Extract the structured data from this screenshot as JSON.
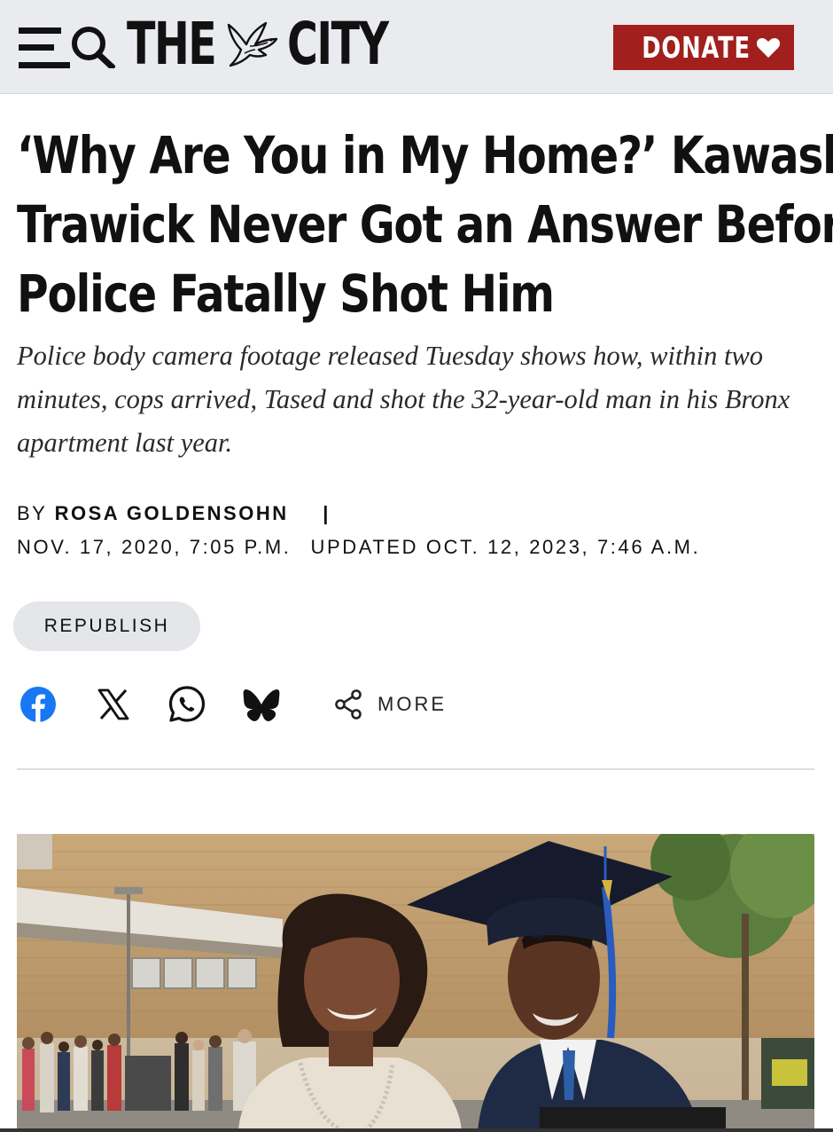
{
  "header": {
    "logo_left": "THE",
    "logo_right": "CITY",
    "donate_label": "DONATE",
    "colors": {
      "bar_bg": "#e9ebee",
      "donate_bg": "#a11f1c"
    },
    "icons": [
      "menu-icon",
      "search-icon",
      "dove-icon",
      "heart-icon"
    ]
  },
  "article": {
    "headline_lines": [
      "‘Why Are You in My Home?’ Kawaski",
      "Trawick Never Got an Answer Before",
      "Police Fatally Shot Him"
    ],
    "dek": "Police body camera footage released Tuesday shows how, within two minutes, cops arrived, Tased and shot the 32-year-old man in his Bronx apartment last year.",
    "byline_prefix": "BY",
    "author": "ROSA GOLDENSOHN",
    "separator": "|",
    "published": "NOV. 17, 2020, 7:05 P.M.",
    "updated": "UPDATED OCT. 12, 2023, 7:46 A.M."
  },
  "actions": {
    "republish_label": "REPUBLISH",
    "share_icons": [
      "facebook-icon",
      "x-icon",
      "whatsapp-icon",
      "bluesky-icon",
      "share-icon"
    ],
    "more_label": "MORE"
  },
  "hero_image": {
    "description_icon": "photo"
  }
}
